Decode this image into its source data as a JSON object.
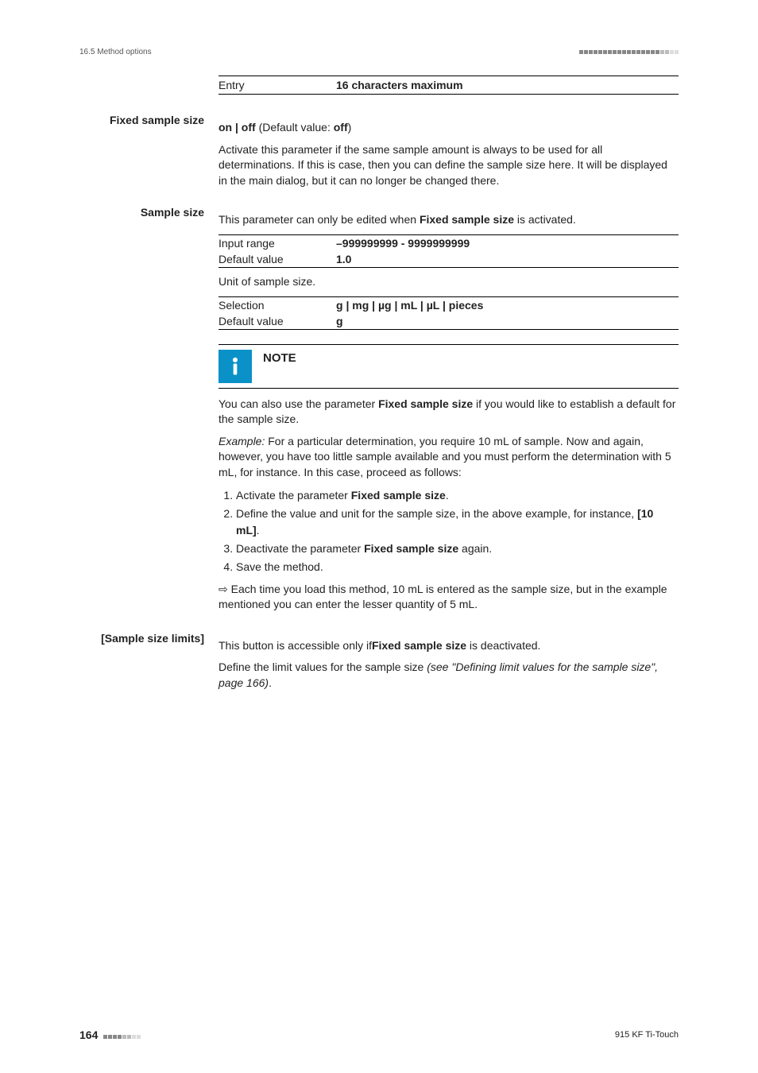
{
  "header": {
    "section": "16.5 Method options"
  },
  "entry_row": {
    "label": "Entry",
    "value": "16 characters maximum"
  },
  "fixed_sample": {
    "heading": "Fixed sample size",
    "line1a": "on | off",
    "line1b": " (Default value: ",
    "line1c": "off",
    "line1d": ")",
    "desc": "Activate this parameter if the same sample amount is always to be used for all determinations. If this is case, then you can define the sample size here. It will be displayed in the main dialog, but it can no longer be changed there."
  },
  "sample_size": {
    "heading": "Sample size",
    "intro_a": "This parameter can only be edited when ",
    "intro_b": "Fixed sample size",
    "intro_c": " is activated.",
    "rows": [
      {
        "label": "Input range",
        "value": "–999999999 - 9999999999"
      },
      {
        "label": "Default value",
        "value": "1.0"
      }
    ],
    "mid": "Unit of sample size.",
    "rows2": [
      {
        "label": "Selection",
        "value": "g | mg | µg | mL | µL | pieces"
      },
      {
        "label": "Default value",
        "value": "g"
      }
    ]
  },
  "note": {
    "title": "NOTE",
    "p1a": "You can also use the parameter ",
    "p1b": "Fixed sample size",
    "p1c": " if you would like to establish a default for the sample size.",
    "p2": "Example:",
    "p2r": " For a particular determination, you require 10 mL of sample. Now and again, however, you have too little sample available and you must perform the determination with 5 mL, for instance. In this case, proceed as follows:",
    "step1a": "Activate the parameter ",
    "step1b": "Fixed sample size",
    "step1c": ".",
    "step2a": "Define the value and unit for the sample size, in the above example, for instance, ",
    "step2b": "[10 mL]",
    "step2c": ".",
    "step3a": "Deactivate the parameter ",
    "step3b": "Fixed sample size",
    "step3c": " again.",
    "step4": "Save the method.",
    "arr": "⇨ Each time you load this method, 10 mL is entered as the sample size, but in the example mentioned you can enter the lesser quantity of 5 mL."
  },
  "limits": {
    "heading": "[Sample size limits]",
    "p1a": "This button is accessible only if",
    "p1b": "Fixed sample size",
    "p1c": " is deactivated.",
    "p2a": "Define the limit values for the sample size ",
    "p2b": "(see \"Defining limit values for the sample size\", page 166)",
    "p2c": "."
  },
  "footer": {
    "page": "164",
    "doc": "915 KF Ti-Touch"
  }
}
